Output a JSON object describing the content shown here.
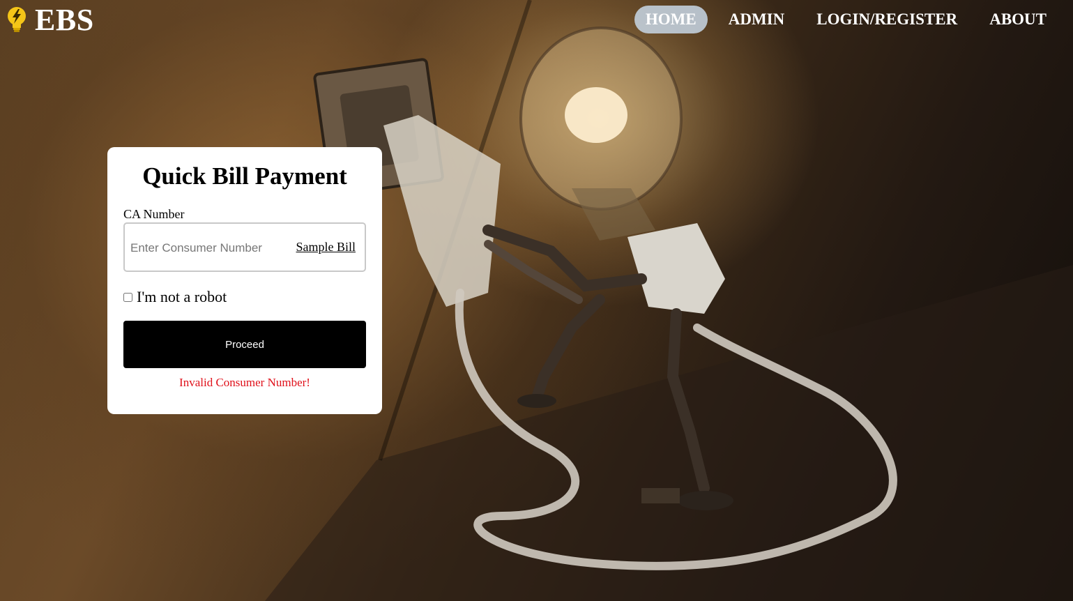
{
  "brand": {
    "icon": "lightbulb-bolt-icon",
    "name": "EBS"
  },
  "nav": {
    "items": [
      {
        "label": "HOME",
        "active": true
      },
      {
        "label": "ADMIN",
        "active": false
      },
      {
        "label": "LOGIN/REGISTER",
        "active": false
      },
      {
        "label": "ABOUT",
        "active": false
      }
    ]
  },
  "card": {
    "title": "Quick Bill Payment",
    "ca_label": "CA Number",
    "ca_input": {
      "placeholder": "Enter Consumer Number",
      "value": ""
    },
    "sample_bill_link": "Sample Bill",
    "captcha_label": "I'm not a robot",
    "captcha_checked": false,
    "proceed_label": "Proceed",
    "error_message": "Invalid Consumer Number!"
  },
  "colors": {
    "nav_active_bg": "#c8d7e6",
    "error_text": "#e0101a",
    "button_bg": "#000000",
    "card_bg": "#ffffff"
  }
}
